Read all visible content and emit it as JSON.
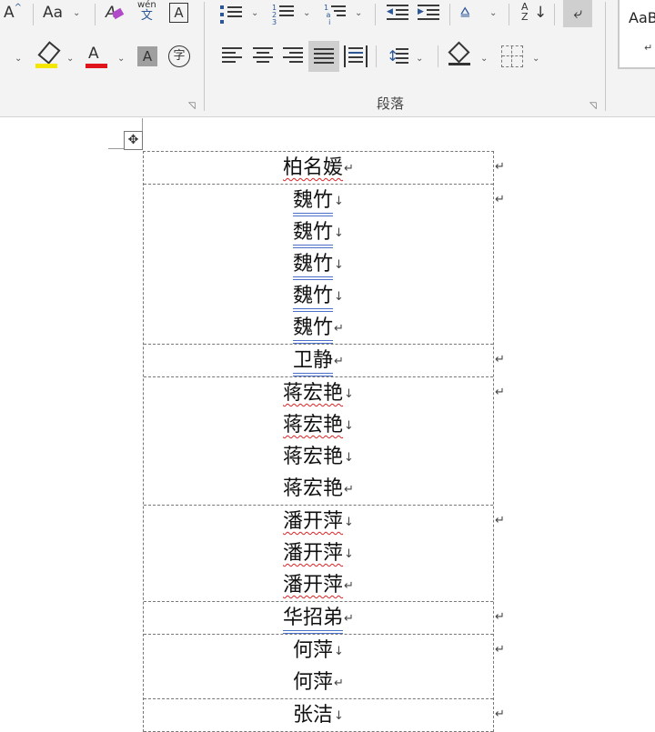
{
  "ribbon": {
    "font_size_up": "A",
    "change_case": "Aa",
    "clear_format": "A",
    "phonetic_top": "wén",
    "phonetic_bottom": "文",
    "char_border": "A",
    "highlight_color": "#f5e600",
    "font_color_letter": "A",
    "font_color": "#e0151b",
    "shading_letter": "A",
    "enclose_char": "字",
    "sort_a": "A",
    "sort_z": "Z",
    "paragraph_group_label": "段落",
    "styles_preview": "AaB",
    "styles_mark": "↵"
  },
  "document": {
    "move_handle": "✥",
    "rows": [
      {
        "lines": [
          {
            "text": "柏名媛",
            "mark": "↵",
            "style": "red"
          }
        ]
      },
      {
        "lines": [
          {
            "text": "魏竹",
            "mark": "↓",
            "style": "blue"
          },
          {
            "text": "魏竹",
            "mark": "↓",
            "style": "blue"
          },
          {
            "text": "魏竹",
            "mark": "↓",
            "style": "blue"
          },
          {
            "text": "魏竹",
            "mark": "↓",
            "style": "blue"
          },
          {
            "text": "魏竹",
            "mark": "↵",
            "style": "blue"
          }
        ]
      },
      {
        "lines": [
          {
            "text": "卫静",
            "mark": "↵",
            "style": "blue"
          }
        ]
      },
      {
        "lines": [
          {
            "text": "蒋宏艳",
            "mark": "↓",
            "style": "red"
          },
          {
            "text": "蒋宏艳",
            "mark": "↓",
            "style": "red"
          },
          {
            "text": "蒋宏艳",
            "mark": "↓",
            "style": "none"
          },
          {
            "text": "蒋宏艳",
            "mark": "↵",
            "style": "none"
          }
        ]
      },
      {
        "lines": [
          {
            "text": "潘开萍",
            "mark": "↓",
            "style": "red"
          },
          {
            "text": "潘开萍",
            "mark": "↓",
            "style": "red"
          },
          {
            "text": "潘开萍",
            "mark": "↵",
            "style": "red"
          }
        ]
      },
      {
        "lines": [
          {
            "text": "华招弟",
            "mark": "↵",
            "style": "blue"
          }
        ]
      },
      {
        "lines": [
          {
            "text": "何萍",
            "mark": "↓",
            "style": "none"
          },
          {
            "text": "何萍",
            "mark": "↵",
            "style": "none"
          }
        ]
      },
      {
        "lines": [
          {
            "text": "张洁",
            "mark": "↓",
            "style": "none"
          }
        ]
      }
    ],
    "end_of_row_mark": "↵"
  }
}
